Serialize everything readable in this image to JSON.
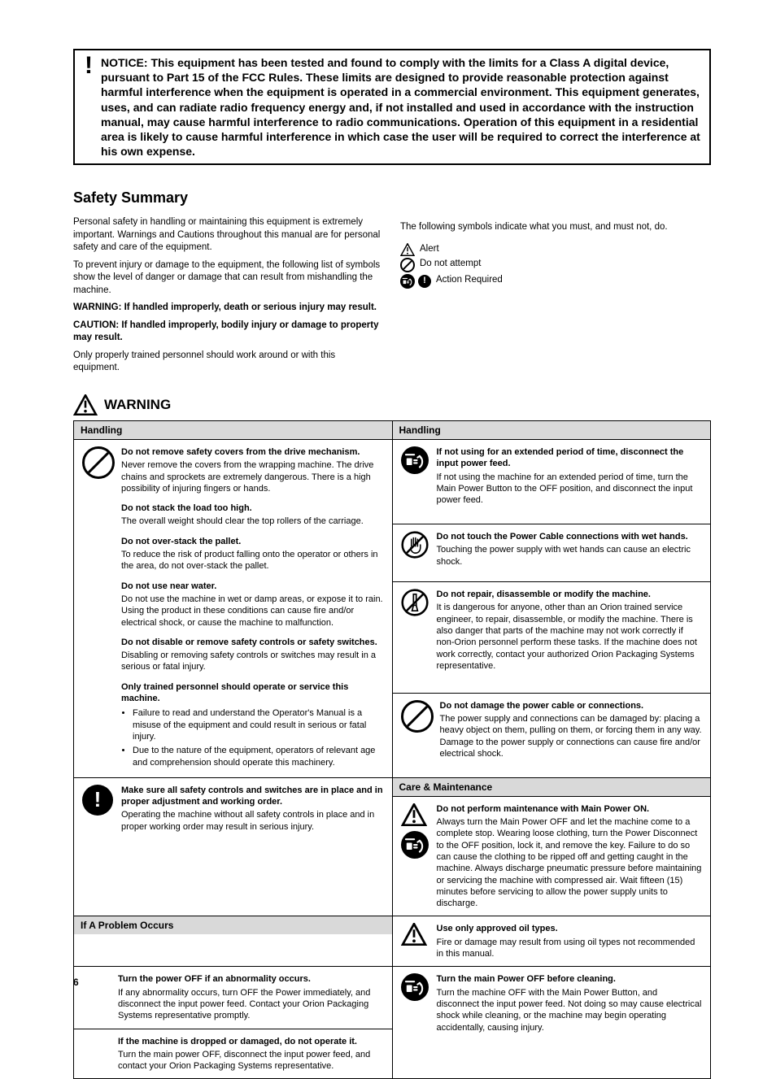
{
  "notice": "NOTICE: This equipment has been tested and found to comply with the limits for a Class A digital device, pursuant to Part 15 of the FCC Rules. These limits are designed to provide reasonable protection against harmful interference when the equipment is operated in a commercial environment. This equipment generates, uses, and can radiate radio frequency energy and, if not installed and used in accordance with the instruction manual, may cause harmful interference to radio communications. Operation of this equipment in a residential area is likely to cause harmful interference in which case the user will be required to correct the interference at his own expense.",
  "safety_title": "Safety Summary",
  "intro_paragraphs": [
    "Personal safety in handling or maintaining this equipment is extremely important. Warnings and Cautions throughout this manual are for personal safety and care of the equipment.",
    "To prevent injury or damage to the equipment, the following list of symbols show the level of danger or damage that can result from mishandling the machine.",
    "WARNING: If handled improperly, death or serious injury may result.",
    "CAUTION: If handled improperly, bodily injury or damage to property may result.",
    "Only properly trained personnel should work around or with this equipment."
  ],
  "icon_legend": [
    "Alert",
    "Do not attempt",
    "Action Required"
  ],
  "icon_legend_intro": "The following symbols indicate what you must, and must not, do.",
  "warning_label": "WARNING",
  "left_column": {
    "handling_header": "Handling",
    "handling": [
      {
        "head": "Do not remove safety covers from the drive mechanism.",
        "body": "Never remove the covers from the wrapping machine. The drive chains and sprockets are extremely dangerous. There is a high possibility of injuring fingers or hands.",
        "bullets": null
      },
      {
        "head": "Do not stack the load too high.",
        "body": "The overall weight should clear the top rollers of the carriage.",
        "bullets": null
      },
      {
        "head": "Do not over-stack the pallet.",
        "body": "To reduce the risk of product falling onto the operator or others in the area, do not over-stack the pallet.",
        "bullets": null
      },
      {
        "head": "Do not use near water.",
        "body": "Do not use the machine in wet or damp areas, or expose it to rain. Using the product in these conditions can cause fire and/or electrical shock, or cause the machine to malfunction.",
        "bullets": null
      },
      {
        "head": "Do not disable or remove safety controls or safety switches.",
        "body": "Disabling or removing safety controls or switches may result in a serious or fatal injury.",
        "bullets": null
      },
      {
        "head": "Only trained personnel should operate or service this machine.",
        "body": null,
        "bullets": [
          "Failure to read and understand the Operator's Manual is a misuse of the equipment and could result in serious or fatal injury.",
          "Due to the nature of the equipment, operators of relevant age and comprehension should operate this machinery."
        ]
      },
      {
        "head": "Make sure all safety controls and switches are in place and in proper adjustment and working order.",
        "body": "Operating the machine without all safety controls in place and in proper working order may result in serious injury.",
        "bullets": null
      }
    ],
    "category_header": "If A Problem Occurs",
    "problems": [
      {
        "head": "Turn the power OFF if an abnormality occurs.",
        "body": "If any abnormality occurs, turn OFF the Power immediately, and disconnect the input power feed. Contact your Orion Packaging Systems representative promptly."
      },
      {
        "head": "If the machine is dropped or damaged, do not operate it.",
        "body": "Turn the main power OFF, disconnect the input power feed, and contact your Orion Packaging Systems representative."
      }
    ]
  },
  "right_column": {
    "handling_header": "Handling",
    "handling": [
      {
        "icon": "unplug",
        "head": "If not using for an extended period of time, disconnect the input power feed.",
        "body": "If not using the machine for an extended period of time, turn the Main Power Button to the OFF position, and disconnect the input power feed."
      },
      {
        "icon": "no-touch",
        "head": "Do not touch the Power Cable connections with wet hands.",
        "body": "Touching the power supply with wet hands can cause an electric shock."
      },
      {
        "icon": "no-disassemble",
        "head": "Do not repair, disassemble or modify the machine.",
        "body": "It is dangerous for anyone, other than an Orion trained service engineer, to repair, disassemble, or modify the machine. There is also danger that parts of the machine may not work correctly if non-Orion personnel perform these tasks. If the machine does not work correctly, contact your authorized Orion Packaging Systems representative."
      },
      {
        "icon": "prohibit",
        "head": "Do not damage the power cable or connections.",
        "body": "The power supply and connections can be damaged by: placing a heavy object on them, pulling on them, or forcing them in any way. Damage to the power supply or connections can cause fire and/or electrical shock."
      }
    ],
    "care_header": "Care & Maintenance",
    "care": [
      {
        "icons": [
          "alert",
          "unplug"
        ],
        "head": "Do not perform maintenance with Main Power ON.",
        "body": "Always turn the Main Power OFF and let the machine come to a complete stop. Wearing loose clothing, turn the Power Disconnect to the OFF position, lock it, and remove the key. Failure to do so can cause the clothing to be ripped off and getting caught in the machine. Always discharge pneumatic pressure before maintaining or servicing the machine with compressed air. Wait fifteen (15) minutes before servicing to allow the power supply units to discharge."
      },
      {
        "icons": [
          "alert"
        ],
        "head": "Use only approved oil types.",
        "body": "Fire or damage may result from using oil types not recommended in this manual."
      },
      {
        "icons": [
          "unplug"
        ],
        "head": "Turn the main Power OFF before cleaning.",
        "body": "Turn the machine OFF with the Main Power Button, and disconnect the input power feed. Not doing so may cause electrical shock while cleaning, or the machine may begin operating accidentally, causing injury."
      }
    ]
  },
  "page_number": "6"
}
